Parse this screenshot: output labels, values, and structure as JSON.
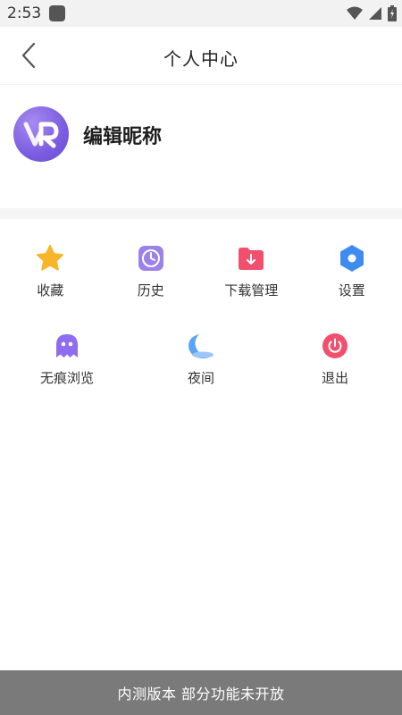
{
  "status_bar": {
    "time": "2:53",
    "icons": [
      "wifi-icon",
      "signal-icon",
      "battery-icon"
    ]
  },
  "header": {
    "title": "个人中心",
    "back_icon": "chevron-left-icon"
  },
  "profile": {
    "nickname": "编辑昵称",
    "avatar_icon": "app-logo"
  },
  "menu_row1": [
    {
      "label": "收藏",
      "icon": "star-icon",
      "color": "#f7b529"
    },
    {
      "label": "历史",
      "icon": "clock-icon",
      "color": "#9b82ea"
    },
    {
      "label": "下载管理",
      "icon": "download-folder-icon",
      "color": "#f0506e"
    },
    {
      "label": "设置",
      "icon": "settings-hexagon-icon",
      "color": "#3f8cf0"
    }
  ],
  "menu_row2": [
    {
      "label": "无痕浏览",
      "icon": "ghost-icon",
      "color": "#8e6df0"
    },
    {
      "label": "夜间",
      "icon": "moon-icon",
      "color": "#5aa3f5"
    },
    {
      "label": "退出",
      "icon": "power-icon",
      "color": "#f0506e"
    }
  ],
  "toast": {
    "text": "内测版本 部分功能未开放"
  }
}
